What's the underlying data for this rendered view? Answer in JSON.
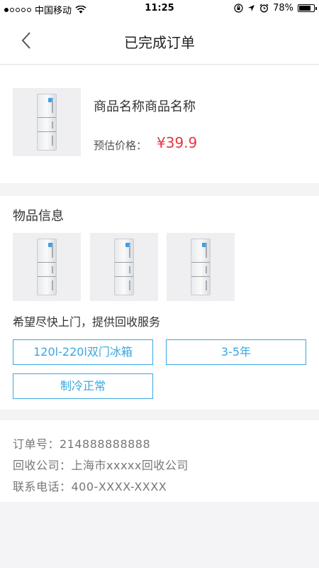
{
  "status_bar": {
    "carrier": "中国移动",
    "time": "11:25",
    "battery": "78%",
    "battery_level": 0.78
  },
  "nav": {
    "title": "已完成订单",
    "back_icon": "chevron-left-icon"
  },
  "product": {
    "name": "商品名称商品名称",
    "price_label": "预估价格：",
    "price": "¥39.9",
    "price_color": "#e8353f"
  },
  "items": {
    "title": "物品信息",
    "image_count": 3,
    "service_text": "希望尽快上门，提供回收服务",
    "tags": [
      "120l-220l双门冰箱",
      "3-5年",
      "制冷正常"
    ],
    "accent_color": "#3aa6e0"
  },
  "order": {
    "order_no": "订单号：214888888888",
    "company": "回收公司：上海市xxxxx回收公司",
    "phone": "联系电话：400-XXXX-XXXX"
  }
}
